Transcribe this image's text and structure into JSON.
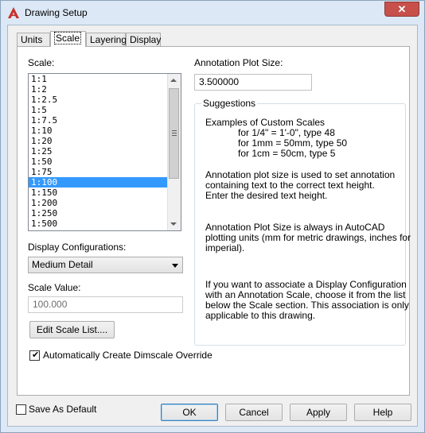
{
  "window": {
    "title": "Drawing Setup",
    "close_glyph": "✕"
  },
  "tabs": [
    {
      "label": "Units"
    },
    {
      "label": "Scale"
    },
    {
      "label": "Layering"
    },
    {
      "label": "Display"
    }
  ],
  "scale": {
    "label": "Scale:",
    "items": [
      "1:1",
      "1:2",
      "1:2.5",
      "1:5",
      "1:7.5",
      "1:10",
      "1:20",
      "1:25",
      "1:50",
      "1:75",
      "1:100",
      "1:150",
      "1:200",
      "1:250",
      "1:500"
    ],
    "selected": "1:100"
  },
  "display_config": {
    "label": "Display Configurations:",
    "value": "Medium Detail"
  },
  "scale_value": {
    "label": "Scale Value:",
    "value": "100.000"
  },
  "edit_scale_button": "Edit Scale List....",
  "dimscale_checkbox": {
    "label": "Automatically Create Dimscale Override",
    "checked": true
  },
  "annotation": {
    "label": "Annotation Plot Size:",
    "value": "3.500000"
  },
  "suggestions": {
    "title": "Suggestions",
    "examples_title": "Examples of Custom Scales",
    "example1": "for 1/4\" = 1'-0\", type 48",
    "example2": "for 1mm = 50mm, type 50",
    "example3": "for 1cm = 50cm, type 5",
    "para1_l1": "Annotation plot size is used to set annotation",
    "para1_l2": "containing text to the correct text height.",
    "para1_l3": "Enter the desired text height.",
    "para2_l1": "Annotation Plot Size is always in AutoCAD",
    "para2_l2": "plotting units (mm for metric drawings, inches for",
    "para2_l3": "imperial).",
    "para3_l1": "If you want to associate a Display Configuration",
    "para3_l2": "with an Annotation Scale, choose it from the list",
    "para3_l3": "below the Scale section.  This association is only",
    "para3_l4": "applicable to this drawing."
  },
  "save_default": {
    "label": "Save As Default",
    "checked": false
  },
  "buttons": {
    "ok": "OK",
    "cancel": "Cancel",
    "apply": "Apply",
    "help": "Help"
  },
  "colors": {
    "selection": "#3399ff",
    "app_icon": "#c8312b"
  },
  "icons": {
    "app": "autocad-a-icon",
    "close": "close-icon",
    "check": "checkmark-icon"
  }
}
